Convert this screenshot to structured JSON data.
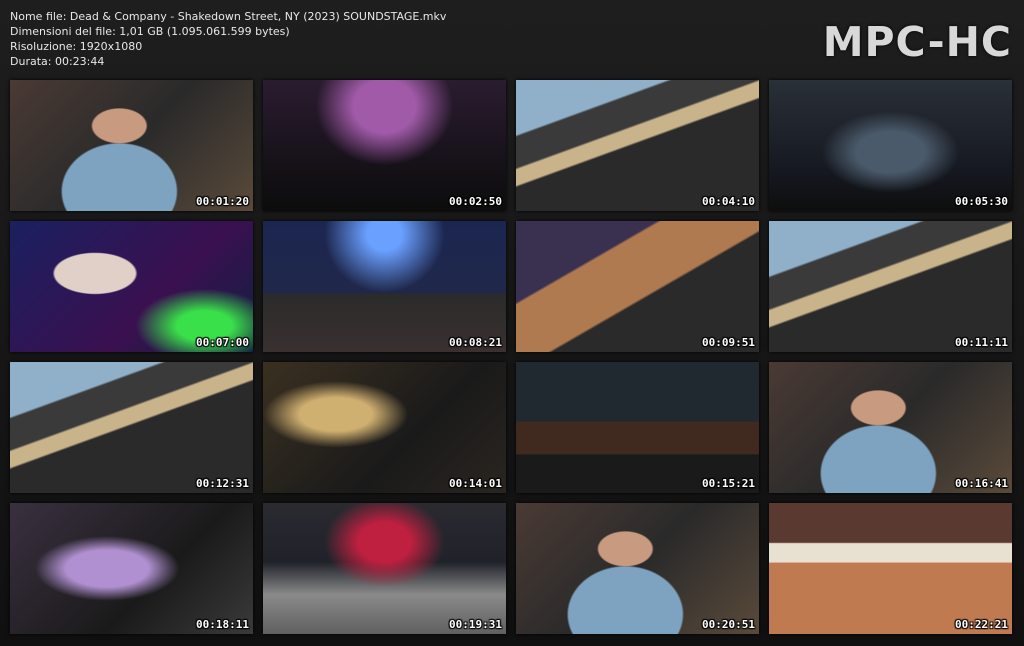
{
  "header": {
    "filename": "Nome file: Dead & Company - Shakedown Street, NY (2023) SOUNDSTAGE.mkv",
    "filesize": "Dimensioni del file: 1,01 GB (1.095.061.599 bytes)",
    "resolution": "Risoluzione: 1920x1080",
    "duration": "Durata: 00:23:44"
  },
  "logo": "MPC-HC",
  "thumbnails": [
    {
      "time": "00:01:20",
      "scene": "s-face"
    },
    {
      "time": "00:02:50",
      "scene": "s-stage"
    },
    {
      "time": "00:04:10",
      "scene": "s-guitar"
    },
    {
      "time": "00:05:30",
      "scene": "s-wide"
    },
    {
      "time": "00:07:00",
      "scene": "s-beard"
    },
    {
      "time": "00:08:21",
      "scene": "s-blue"
    },
    {
      "time": "00:09:51",
      "scene": "s-bass"
    },
    {
      "time": "00:11:11",
      "scene": "s-guitar"
    },
    {
      "time": "00:12:31",
      "scene": "s-guitar"
    },
    {
      "time": "00:14:01",
      "scene": "s-drum"
    },
    {
      "time": "00:15:21",
      "scene": "s-keys"
    },
    {
      "time": "00:16:41",
      "scene": "s-face"
    },
    {
      "time": "00:18:11",
      "scene": "s-purple"
    },
    {
      "time": "00:19:31",
      "scene": "s-crowd"
    },
    {
      "time": "00:20:51",
      "scene": "s-face"
    },
    {
      "time": "00:22:21",
      "scene": "s-organ"
    }
  ]
}
